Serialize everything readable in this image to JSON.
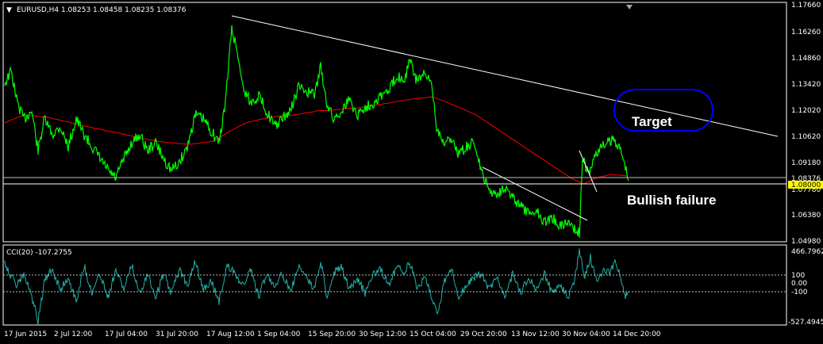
{
  "header": {
    "symbol_line": "EURUSD,H4  1.08253 1.08458 1.08235 1.08376",
    "dropdown_glyph": "▼"
  },
  "indicator": {
    "label": "CCI(20) -107.2755",
    "axis": {
      "top": "466.7962",
      "l100": "100",
      "l0": "0.00",
      "lm100": "-100",
      "bottom": "-527.4945"
    }
  },
  "price_axis": {
    "labels": [
      "1.17660",
      "1.16260",
      "1.14860",
      "1.13420",
      "1.12020",
      "1.10620",
      "1.09180",
      "1.07780",
      "1.06380",
      "1.04980"
    ],
    "current_price": "1.08376",
    "horizontal_line_price": "1.08000"
  },
  "time_axis": {
    "labels": [
      "17 Jun 2015",
      "2 Jul 12:00",
      "17 Jul 04:00",
      "31 Jul 20:00",
      "17 Aug 12:00",
      "1 Sep 04:00",
      "15 Sep 20:00",
      "30 Sep 12:00",
      "15 Oct 04:00",
      "29 Oct 20:00",
      "13 Nov 12:00",
      "30 Nov 04:00",
      "14 Dec 20:00"
    ]
  },
  "annotations": {
    "target": "Target",
    "bullish_failure": "Bullish failure"
  },
  "colors": {
    "background": "#000000",
    "price_line": "#00ff00",
    "moving_average": "#ff0000",
    "cci_line": "#20b2aa",
    "trendline": "#ffffff",
    "target_ellipse": "#0000ff",
    "price_marker_bg": "#ffff00"
  },
  "chart_data": {
    "type": "line",
    "title": "EURUSD,H4",
    "series": [
      {
        "name": "EURUSD",
        "x": [
          "17 Jun 2015",
          "2 Jul 12:00",
          "17 Jul 04:00",
          "31 Jul 20:00",
          "17 Aug 12:00",
          "1 Sep 04:00",
          "15 Sep 20:00",
          "30 Sep 12:00",
          "15 Oct 04:00",
          "29 Oct 20:00",
          "13 Nov 12:00",
          "30 Nov 04:00",
          "14 Dec 20:00"
        ],
        "values": [
          1.135,
          1.11,
          1.087,
          1.095,
          1.17,
          1.125,
          1.128,
          1.12,
          1.14,
          1.1,
          1.065,
          1.085,
          1.08
        ]
      }
    ],
    "ylim": [
      1.0498,
      1.1766
    ]
  }
}
